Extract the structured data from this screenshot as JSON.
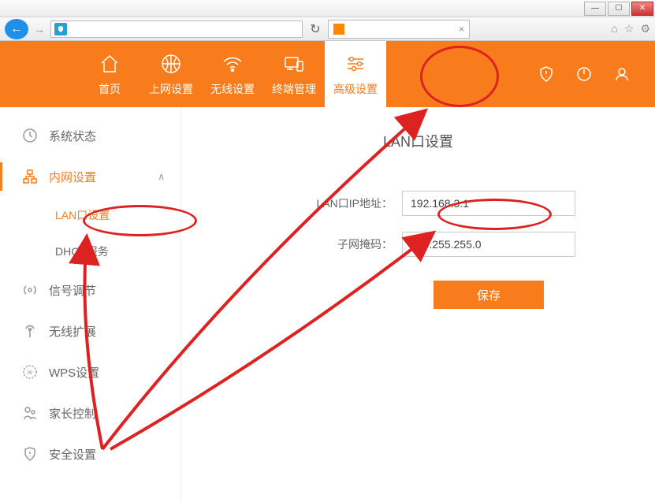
{
  "window": {
    "min": "—",
    "max": "☐",
    "close": "✕"
  },
  "toolbar": {
    "back": "←",
    "forward": "→",
    "refresh": "↻",
    "tab_close": "×",
    "icons": {
      "home": "⌂",
      "star": "☆",
      "gear": "⚙"
    }
  },
  "nav": {
    "items": [
      {
        "label": "首页"
      },
      {
        "label": "上网设置"
      },
      {
        "label": "无线设置"
      },
      {
        "label": "终端管理"
      },
      {
        "label": "高级设置"
      }
    ]
  },
  "sidebar": {
    "items": [
      {
        "label": "系统状态"
      },
      {
        "label": "内网设置",
        "expanded": true,
        "children": [
          {
            "label": "LAN口设置",
            "active": true
          },
          {
            "label": "DHCP服务"
          }
        ]
      },
      {
        "label": "信号调节"
      },
      {
        "label": "无线扩展"
      },
      {
        "label": "WPS设置"
      },
      {
        "label": "家长控制"
      },
      {
        "label": "安全设置"
      }
    ]
  },
  "main": {
    "title": "LAN口设置",
    "ip_label": "LAN口IP地址：",
    "ip_value": "192.168.3.1",
    "mask_label": "子网掩码：",
    "mask_value": "255.255.255.0",
    "save": "保存"
  }
}
